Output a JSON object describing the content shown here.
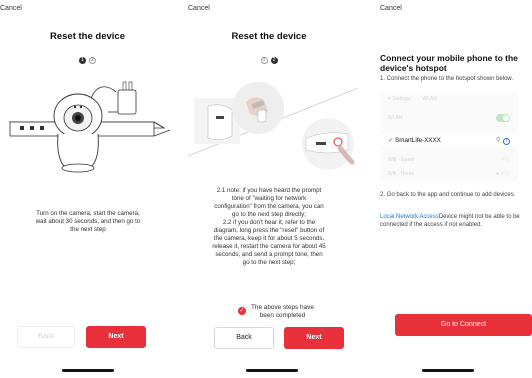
{
  "screen1": {
    "cancel": "Cancel",
    "title": "Reset the device",
    "steps": [
      "1",
      "2"
    ],
    "instruction": "Turn on the camera, start the camera,\nwait about 30 seconds, and then go to\nthe next step",
    "back_label": "Back",
    "next_label": "Next"
  },
  "screen2": {
    "cancel": "Cancel",
    "title": "Reset the device",
    "steps": [
      "1",
      "2"
    ],
    "instruction": "2.1 note: if you have heard the prompt\ntone of \"waiting for network\nconfiguration\" from the camera, you can\ngo to the next step directly;\n2.2 if you don't hear it, refer to the\ndiagram, long press the \"reset\" button of\nthe camera, keep it for about 5 seconds,\nrelease it, restart the camera for about 45\nseconds, and send a prompt tone, then\ngo to the next step;",
    "confirm_text": "The above steps have\nbeen completed",
    "back_label": "Back",
    "next_label": "Next"
  },
  "screen3": {
    "cancel": "Cancel",
    "title": "Connect your mobile phone to the device's hotspot",
    "step1": "1. Connect the phone to the hotspot shown below.",
    "wifi": {
      "back": "< Settings",
      "header": "WLAN",
      "wlan_label": "WLAN",
      "selected_network": "SmartLife-XXXX",
      "other1": "Wifi - Guest",
      "other2": "Wifi - Home"
    },
    "step2": "2. Go back to the app and continue to add devices.",
    "link_text": "Local Network Access",
    "note": "Device might not be able to be connected if the access if not enabled.",
    "connect_label": "Go to Connect"
  },
  "colors": {
    "accent": "#e8303a",
    "link": "#2a72d4"
  }
}
